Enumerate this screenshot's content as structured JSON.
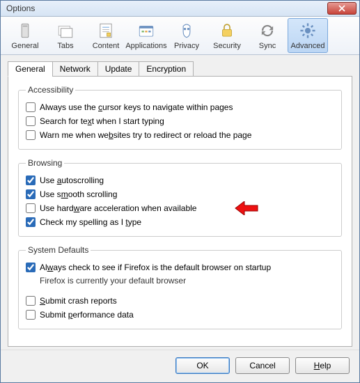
{
  "window": {
    "title": "Options"
  },
  "toolbar": {
    "items": [
      {
        "label": "General",
        "name": "general"
      },
      {
        "label": "Tabs",
        "name": "tabs"
      },
      {
        "label": "Content",
        "name": "content"
      },
      {
        "label": "Applications",
        "name": "applications"
      },
      {
        "label": "Privacy",
        "name": "privacy"
      },
      {
        "label": "Security",
        "name": "security"
      },
      {
        "label": "Sync",
        "name": "sync"
      },
      {
        "label": "Advanced",
        "name": "advanced"
      }
    ],
    "selected": "Advanced"
  },
  "subtabs": {
    "items": [
      "General",
      "Network",
      "Update",
      "Encryption"
    ],
    "active": "General"
  },
  "groups": {
    "accessibility": {
      "legend": "Accessibility",
      "items": [
        {
          "label_pre": "Always use the ",
          "mn": "c",
          "label_post": "ursor keys to navigate within pages",
          "checked": false
        },
        {
          "label_pre": "Search for te",
          "mn": "x",
          "label_post": "t when I start typing",
          "checked": false
        },
        {
          "label_pre": "Warn me when we",
          "mn": "b",
          "label_post": "sites try to redirect or reload the page",
          "checked": false
        }
      ]
    },
    "browsing": {
      "legend": "Browsing",
      "items": [
        {
          "label_pre": "Use ",
          "mn": "a",
          "label_post": "utoscrolling",
          "checked": true
        },
        {
          "label_pre": "Use s",
          "mn": "m",
          "label_post": "ooth scrolling",
          "checked": true
        },
        {
          "label_pre": "Use hard",
          "mn": "w",
          "label_post": "are acceleration when available",
          "checked": false,
          "arrow": true
        },
        {
          "label_pre": "Check my spelling as I ",
          "mn": "t",
          "label_post": "ype",
          "checked": true
        }
      ]
    },
    "system": {
      "legend": "System Defaults",
      "items": [
        {
          "label_pre": "Al",
          "mn": "w",
          "label_post": "ays check to see if Firefox is the default browser on startup",
          "checked": true
        }
      ],
      "note": "Firefox is currently your default browser",
      "items2": [
        {
          "label_pre": "",
          "mn": "S",
          "label_post": "ubmit crash reports",
          "checked": false
        },
        {
          "label_pre": "Submit ",
          "mn": "p",
          "label_post": "erformance data",
          "checked": false
        }
      ]
    }
  },
  "buttons": {
    "ok": "OK",
    "cancel": "Cancel",
    "help_mn": "H",
    "help_post": "elp"
  }
}
